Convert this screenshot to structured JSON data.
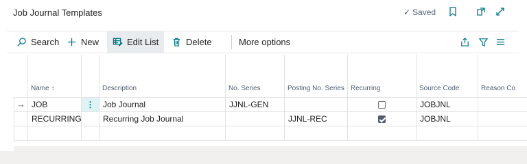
{
  "header": {
    "title": "Job Journal Templates",
    "saved_label": "Saved",
    "saved_check": "✓"
  },
  "toolbar": {
    "search_label": "Search",
    "new_label": "New",
    "edit_list_label": "Edit List",
    "delete_label": "Delete",
    "more_options_label": "More options"
  },
  "grid": {
    "columns": [
      {
        "label": "Name ↑"
      },
      {
        "label": ""
      },
      {
        "label": "Description"
      },
      {
        "label": "No. Series"
      },
      {
        "label": "Posting No. Series"
      },
      {
        "label": "Recurring"
      },
      {
        "label": "Source Code"
      },
      {
        "label": "Reason Co"
      }
    ],
    "rows": [
      {
        "indicator": "→",
        "name": "JOB",
        "dots": "⋮",
        "description": "Job Journal",
        "no_series": "JJNL-GEN",
        "posting_no_series": "",
        "recurring": false,
        "source_code": "JOBJNL",
        "reason_code": ""
      },
      {
        "indicator": "",
        "name": "RECURRING",
        "dots": "",
        "description": "Recurring Job Journal",
        "no_series": "",
        "posting_no_series": "JJNL-REC",
        "recurring": true,
        "source_code": "JOBJNL",
        "reason_code": ""
      }
    ]
  },
  "colors": {
    "accent": "#00788a",
    "selected_cell": "#dff3f4",
    "active_action": "#e9ecee"
  }
}
